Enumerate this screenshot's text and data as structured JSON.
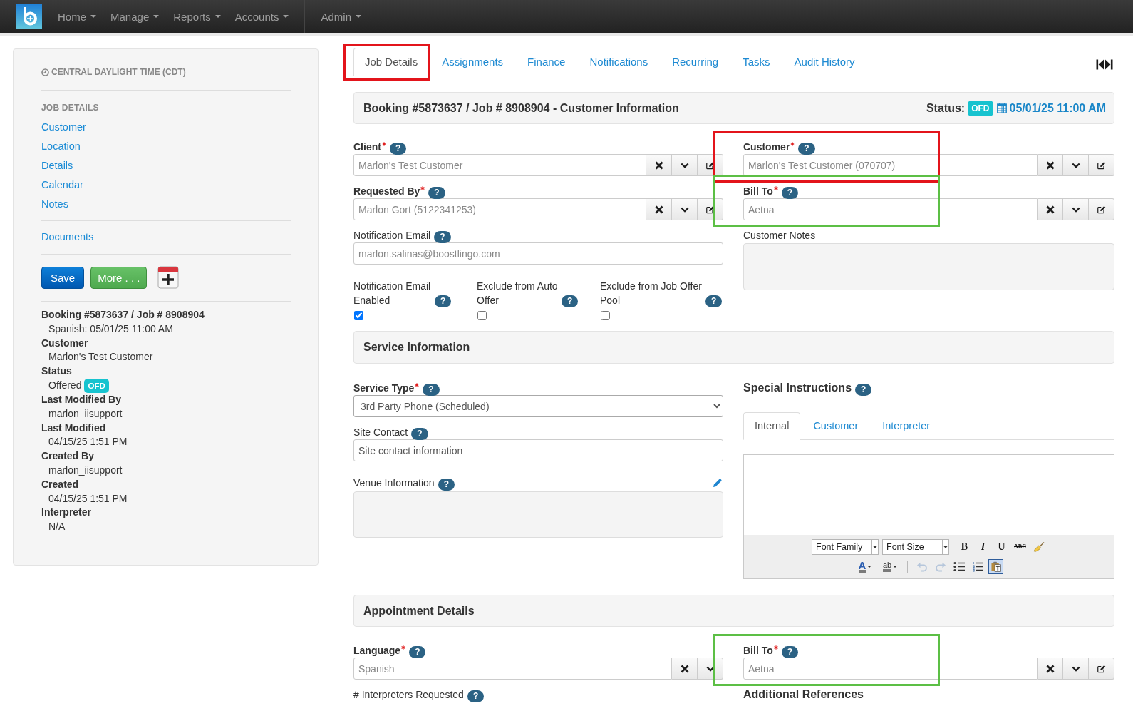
{
  "navbar": {
    "menu_groups": [
      [
        {
          "label": "Home"
        },
        {
          "label": "Manage"
        },
        {
          "label": "Reports"
        },
        {
          "label": "Accounts"
        }
      ],
      [
        {
          "label": "Admin"
        }
      ]
    ]
  },
  "sidebar": {
    "timezone": "CENTRAL DAYLIGHT TIME (CDT)",
    "section_title": "JOB DETAILS",
    "links": [
      "Customer",
      "Location",
      "Details",
      "Calendar",
      "Notes"
    ],
    "more_links": [
      "Documents"
    ],
    "buttons": [
      {
        "label": "Save",
        "kind": "primary"
      },
      {
        "label": "More . . .",
        "kind": "success"
      }
    ],
    "summary": [
      {
        "label": "Booking #5873637 / Job # 8908904",
        "value": "Spanish: 05/01/25 11:00 AM"
      },
      {
        "label": "Customer",
        "value": "Marlon's Test Customer"
      },
      {
        "label": "Status",
        "value": "Offered",
        "badge": "OFD"
      },
      {
        "label": "Last Modified By",
        "value": "marlon_iisupport"
      },
      {
        "label": "Last Modified",
        "value": "04/15/25 1:51 PM"
      },
      {
        "label": "Created By",
        "value": "marlon_iisupport"
      },
      {
        "label": "Created",
        "value": "04/15/25 1:51 PM"
      },
      {
        "label": "Interpreter",
        "value": "N/A"
      }
    ]
  },
  "tabs": [
    {
      "label": "Job Details",
      "selected": true,
      "annotation": {
        "color": "#e3141b"
      }
    },
    {
      "label": "Assignments",
      "selected": false
    },
    {
      "label": "Finance",
      "selected": false
    },
    {
      "label": "Notifications",
      "selected": false
    },
    {
      "label": "Recurring",
      "selected": false
    },
    {
      "label": "Tasks",
      "selected": false
    },
    {
      "label": "Audit History",
      "selected": false
    }
  ],
  "header": {
    "title": "Booking #5873637 / Job # 8908904 - Customer Information",
    "status_label": "Status:",
    "status_badge": "OFD",
    "date": "05/01/25 11:00 AM"
  },
  "customer_info": {
    "left": [
      {
        "kind": "lookup",
        "label": "Client",
        "required": true,
        "help": "?",
        "value": "Marlon's Test Customer",
        "editable": true
      },
      {
        "kind": "lookup",
        "label": "Requested By",
        "required": true,
        "help": "?",
        "value": "Marlon Gort (5122341253)",
        "editable": true
      },
      {
        "kind": "text",
        "label": "Notification Email",
        "required": false,
        "help": "?",
        "value": "marlon.salinas@boostlingo.com"
      }
    ],
    "checkboxes": [
      {
        "label": "Notification Email Enabled",
        "help": "?",
        "checked": true
      },
      {
        "label": "Exclude from Auto Offer",
        "help": "?",
        "checked": false
      },
      {
        "label": "Exclude from Job Offer Pool",
        "help": "?",
        "checked": false
      }
    ],
    "right": [
      {
        "kind": "lookup",
        "label": "Customer",
        "required": true,
        "help": "?",
        "value": "Marlon's Test Customer (070707)",
        "editable": true,
        "annotation": {
          "color": "#e3141b"
        }
      },
      {
        "kind": "lookup",
        "label": "Bill To",
        "required": true,
        "help": "?",
        "value": "Aetna",
        "editable": true,
        "annotation": {
          "color": "#5cbf45"
        }
      },
      {
        "kind": "textarea",
        "label": "Customer Notes",
        "required": false,
        "editable": false
      }
    ]
  },
  "service_info": {
    "title": "Service Information",
    "left": [
      {
        "kind": "select",
        "label": "Service Type",
        "required": true,
        "help": "?",
        "value": "3rd Party Phone (Scheduled)"
      },
      {
        "kind": "text",
        "label": "Site Contact",
        "required": false,
        "help": "?",
        "placeholder": "Site contact information"
      },
      {
        "kind": "textarea",
        "label": "Venue Information",
        "required": false,
        "help": "?",
        "editable": true
      }
    ],
    "right": {
      "heading": "Special Instructions",
      "help": "?",
      "tabs": [
        {
          "label": "Internal",
          "selected": true
        },
        {
          "label": "Customer",
          "selected": false
        },
        {
          "label": "Interpreter",
          "selected": false
        }
      ],
      "editor": {
        "selects": [
          "Font Family",
          "Font Size"
        ],
        "format_buttons": [
          {
            "kind": "bold",
            "label": "B",
            "disabled": false,
            "active": false
          },
          {
            "kind": "italic",
            "label": "I",
            "disabled": false,
            "active": false
          },
          {
            "kind": "underline",
            "label": "U",
            "disabled": false,
            "active": false
          },
          {
            "kind": "strike",
            "label": "ABC",
            "disabled": false,
            "active": false
          },
          {
            "kind": "eraser",
            "disabled": false,
            "active": false
          }
        ],
        "tool_groups": [
          [
            {
              "kind": "font_color",
              "label": "A",
              "disabled": false,
              "active": false
            },
            {
              "kind": "highlight",
              "label": "ab",
              "disabled": false,
              "active": false
            }
          ],
          [
            {
              "kind": "undo",
              "disabled": true,
              "active": false
            },
            {
              "kind": "redo",
              "disabled": true,
              "active": false
            },
            {
              "kind": "bullets",
              "disabled": false,
              "active": false
            },
            {
              "kind": "numbers",
              "disabled": false,
              "active": false
            },
            {
              "kind": "paste_text",
              "disabled": false,
              "active": true
            }
          ]
        ]
      }
    }
  },
  "appointment": {
    "title": "Appointment Details",
    "left": [
      {
        "kind": "lookup",
        "label": "Language",
        "required": true,
        "help": "?",
        "value": "Spanish",
        "editable": false
      },
      {
        "kind": "label",
        "label": "# Interpreters Requested",
        "required": false,
        "help": "?"
      }
    ],
    "right": [
      {
        "kind": "lookup",
        "label": "Bill To",
        "required": true,
        "help": "?",
        "value": "Aetna",
        "editable": true,
        "annotation": {
          "color": "#5cbf45"
        }
      },
      {
        "kind": "heading",
        "label": "Additional References"
      }
    ]
  }
}
